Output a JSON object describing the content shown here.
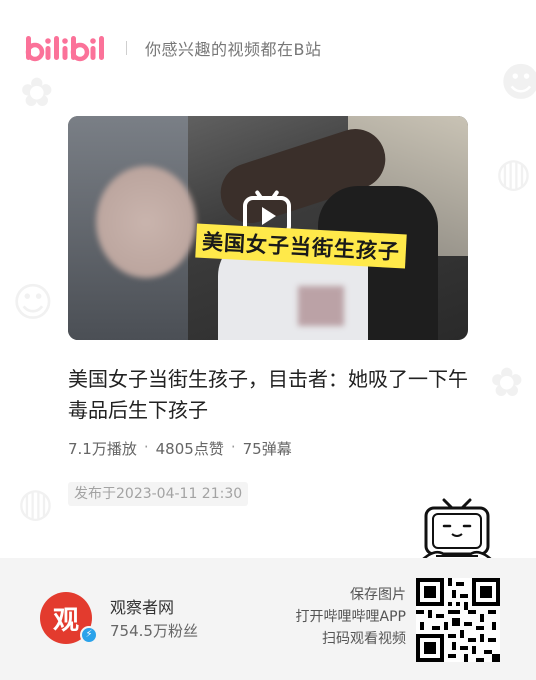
{
  "header": {
    "logo_text": "bilibili",
    "slogan": "你感兴趣的视频都在B站"
  },
  "video": {
    "overlay_caption": "美国女子当街生孩子",
    "title": "美国女子当街生孩子，目击者：她吸了一下午毒品后生下孩子",
    "stats": {
      "plays": "7.1万播放",
      "likes": "4805点赞",
      "danmaku": "75弹幕",
      "separator": "·"
    },
    "publish_time": "发布于2023-04-11 21:30"
  },
  "footer": {
    "author": {
      "avatar_glyph": "观",
      "name": "观察者网",
      "fans": "754.5万粉丝",
      "verified": true
    },
    "save_lines": [
      "保存图片",
      "打开哔哩哔哩APP",
      "扫码观看视频"
    ]
  },
  "colors": {
    "brand_pink": "#fb7299",
    "avatar_red": "#e33b2e",
    "verify_blue": "#2aa2ea",
    "caption_yellow": "#ffe94a"
  },
  "icons": [
    "bilibili-logo",
    "play-icon",
    "tv-mascot-icon",
    "verify-badge-icon",
    "qr-code"
  ]
}
